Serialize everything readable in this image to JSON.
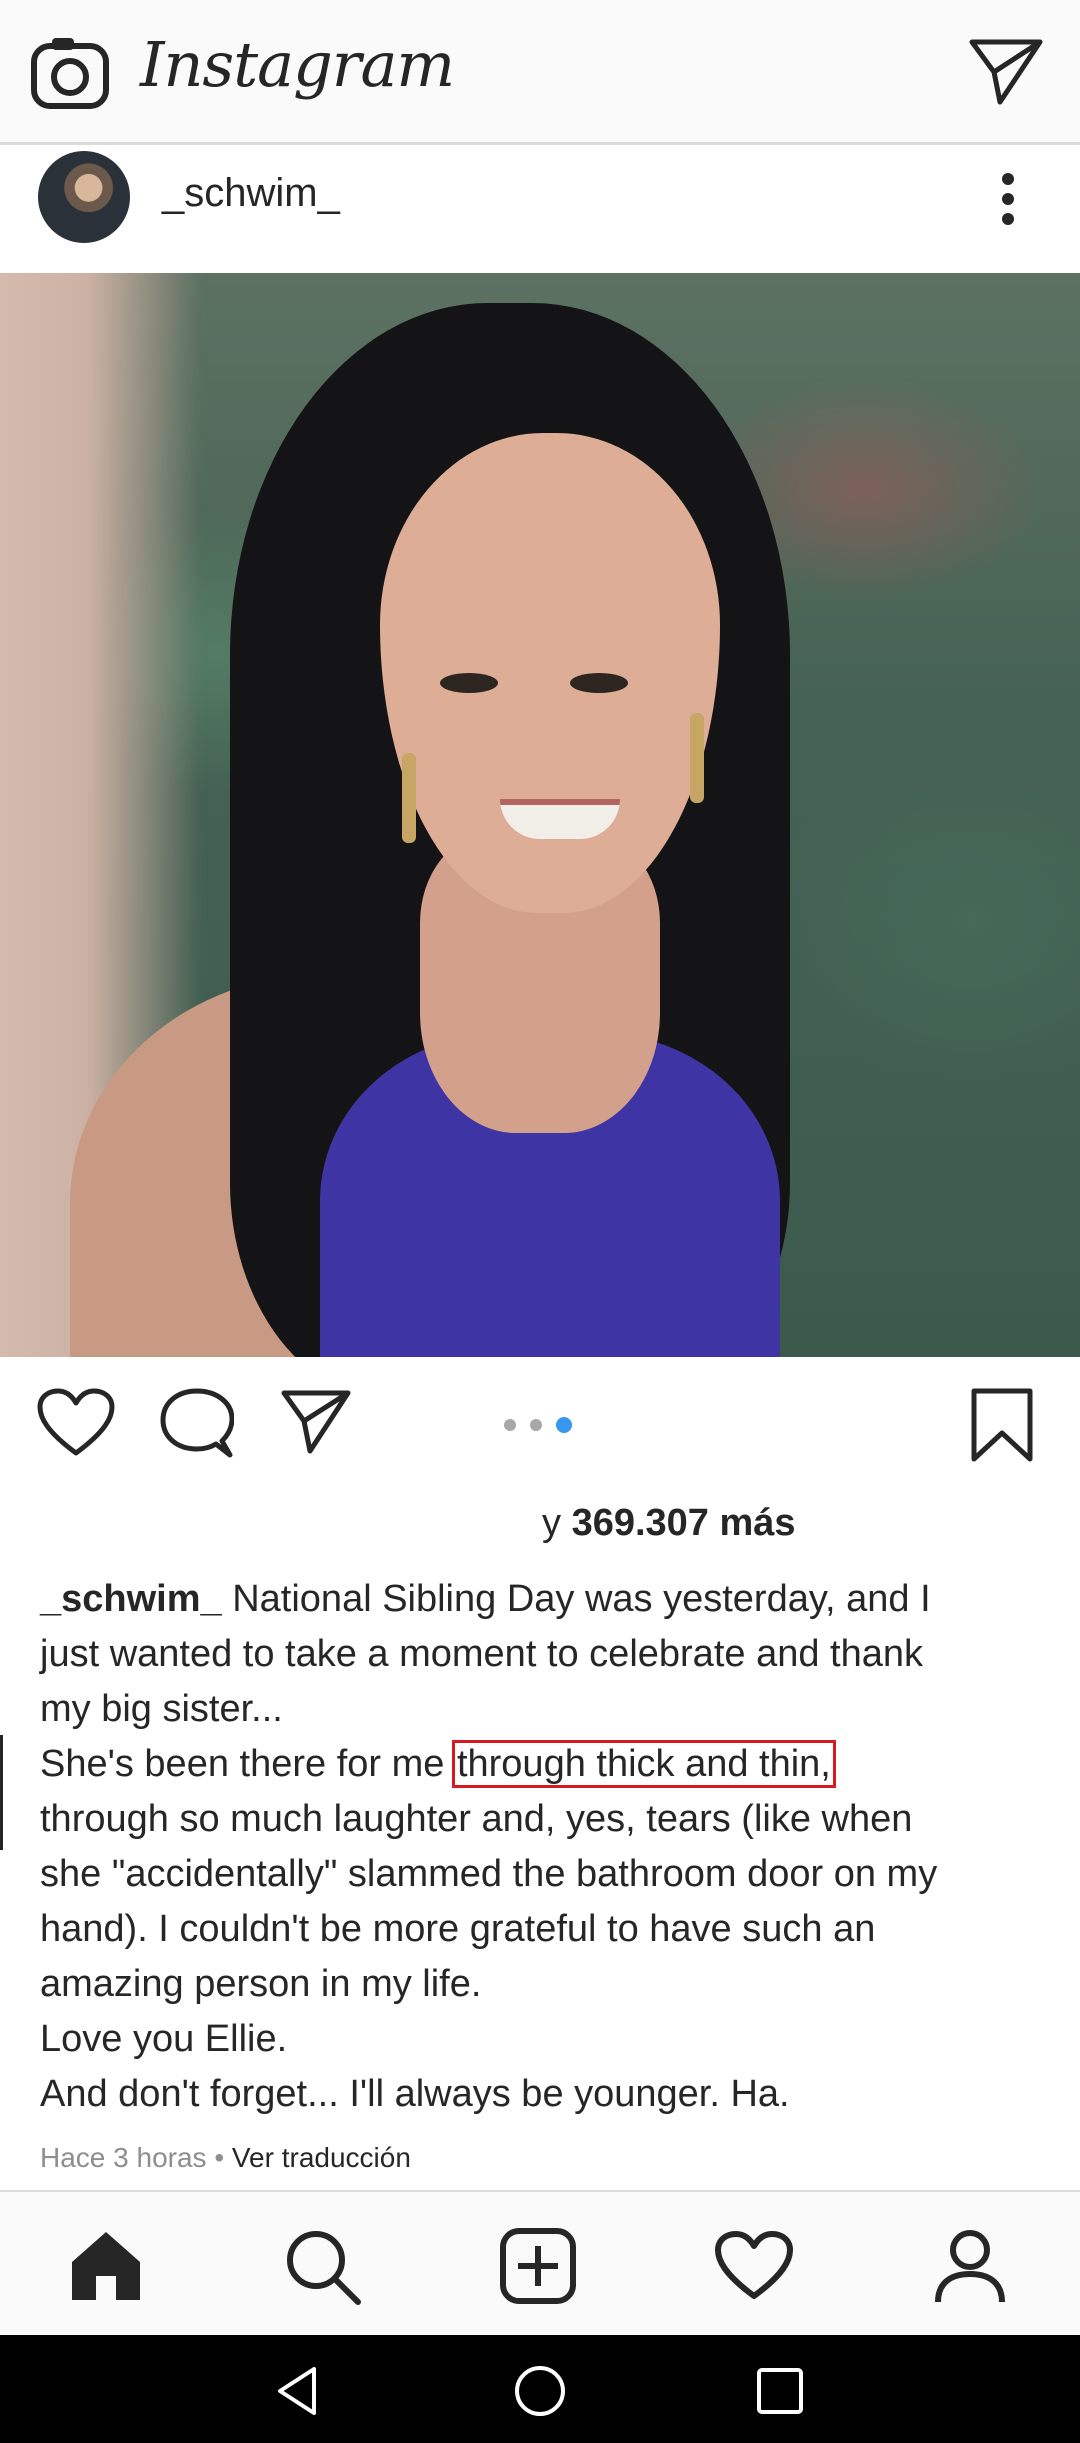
{
  "header": {
    "brand": "Instagram",
    "camera_icon": "camera-icon",
    "direct_icon": "direct-message-icon"
  },
  "post": {
    "username": "_schwim_",
    "more_icon": "more-vertical-icon",
    "carousel": {
      "count": 3,
      "active_index": 3
    },
    "likes": {
      "prefix": "y",
      "count": "369.307 más"
    },
    "caption": {
      "username": "_schwim_",
      "lines": [
        "National Sibling Day was yesterday, and I",
        "just wanted to take a moment to celebrate and thank",
        "my big sister...",
        "She's been there for me",
        "through thick and thin,",
        "through so much laughter and, yes, tears (like when",
        "she \"accidentally\" slammed the bathroom door on my",
        "hand). I couldn't be more grateful to have such an",
        "amazing person in my life.",
        "Love you Ellie.",
        "And don't forget... I'll always be younger.  Ha."
      ]
    },
    "time": "Hace 3 horas",
    "separator": "•",
    "translate": "Ver traducción"
  },
  "nav": {
    "items": [
      "home-icon",
      "search-icon",
      "add-post-icon",
      "activity-heart-icon",
      "profile-icon"
    ]
  },
  "colors": {
    "accent": "#3897f0",
    "highlight_box": "#d71920",
    "text": "#262626",
    "muted": "#8e8e8e"
  }
}
